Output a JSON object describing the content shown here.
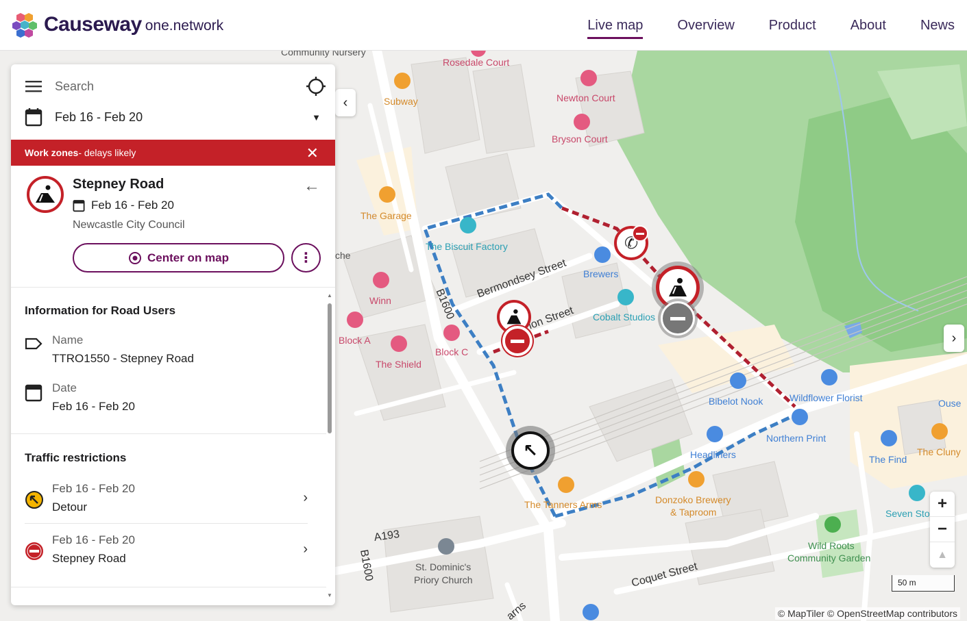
{
  "header": {
    "brand": "Causeway",
    "brand_sub": "one.network",
    "nav": [
      "Live map",
      "Overview",
      "Product",
      "About",
      "News"
    ],
    "active_nav": "Live map"
  },
  "panel": {
    "search_placeholder": "Search",
    "date_range": "Feb 16 - Feb 20",
    "banner_bold": "Work zones",
    "banner_text": " - delays likely",
    "detail": {
      "title": "Stepney Road",
      "dates": "Feb 16 - Feb 20",
      "org": "Newcastle City Council",
      "center_label": "Center on map"
    },
    "info": {
      "heading": "Information for Road Users",
      "name_label": "Name",
      "name_value": "TTRO1550 - Stepney Road",
      "date_label": "Date",
      "date_value": "Feb 16 - Feb 20"
    },
    "restrictions": {
      "heading": "Traffic restrictions",
      "items": [
        {
          "dates": "Feb 16 - Feb 20",
          "name": "Detour",
          "icon": "detour-icon",
          "color": "#f4b400"
        },
        {
          "dates": "Feb 16 - Feb 20",
          "name": "Stepney Road",
          "icon": "no-entry-icon",
          "color": "#c42128"
        }
      ]
    }
  },
  "map": {
    "pois": [
      {
        "label": "Rosedale Court",
        "kind": "pink"
      },
      {
        "label": "Newton Court",
        "kind": "pink"
      },
      {
        "label": "Bryson Court",
        "kind": "pink"
      },
      {
        "label": "Subway",
        "kind": "orange"
      },
      {
        "label": "The Garage",
        "kind": "orange"
      },
      {
        "label": "The Biscuit Factory",
        "kind": "teal"
      },
      {
        "label": "Brewers",
        "kind": "blue"
      },
      {
        "label": "Cobalt Studios",
        "kind": "teal"
      },
      {
        "label": "Winn",
        "kind": "pink"
      },
      {
        "label": "Block A",
        "kind": "pink"
      },
      {
        "label": "Block C",
        "kind": "pink"
      },
      {
        "label": "The Shield",
        "kind": "pink"
      },
      {
        "label": "Bibelot Nook",
        "kind": "blue"
      },
      {
        "label": "Wildflower Florist",
        "kind": "blue"
      },
      {
        "label": "Northern Print",
        "kind": "blue"
      },
      {
        "label": "Headliners",
        "kind": "blue"
      },
      {
        "label": "Ouse",
        "kind": "blue"
      },
      {
        "label": "The Find",
        "kind": "blue"
      },
      {
        "label": "The Cluny",
        "kind": "orange"
      },
      {
        "label": "Seven Sto",
        "kind": "teal"
      },
      {
        "label": "The Tanners Arms",
        "kind": "orange"
      },
      {
        "label": "Donzoko Brewery",
        "kind": "orange"
      },
      {
        "label": "& Taproom",
        "kind": "orange"
      },
      {
        "label": "Wild Roots",
        "kind": "green"
      },
      {
        "label": "Community Garden",
        "kind": "green"
      },
      {
        "label": "St. Dominic's",
        "kind": "grey"
      },
      {
        "label": "Priory Church",
        "kind": "grey"
      },
      {
        "label": "Community Nursery",
        "kind": "grey"
      },
      {
        "label": "che",
        "kind": "grey"
      }
    ],
    "streets": [
      "Bermondsey Street",
      "ion Street",
      "B1600",
      "A193",
      "B1600",
      "Coquet Street",
      "arns"
    ],
    "scale": "50 m",
    "attribution": "© MapTiler © OpenStreetMap contributors"
  }
}
